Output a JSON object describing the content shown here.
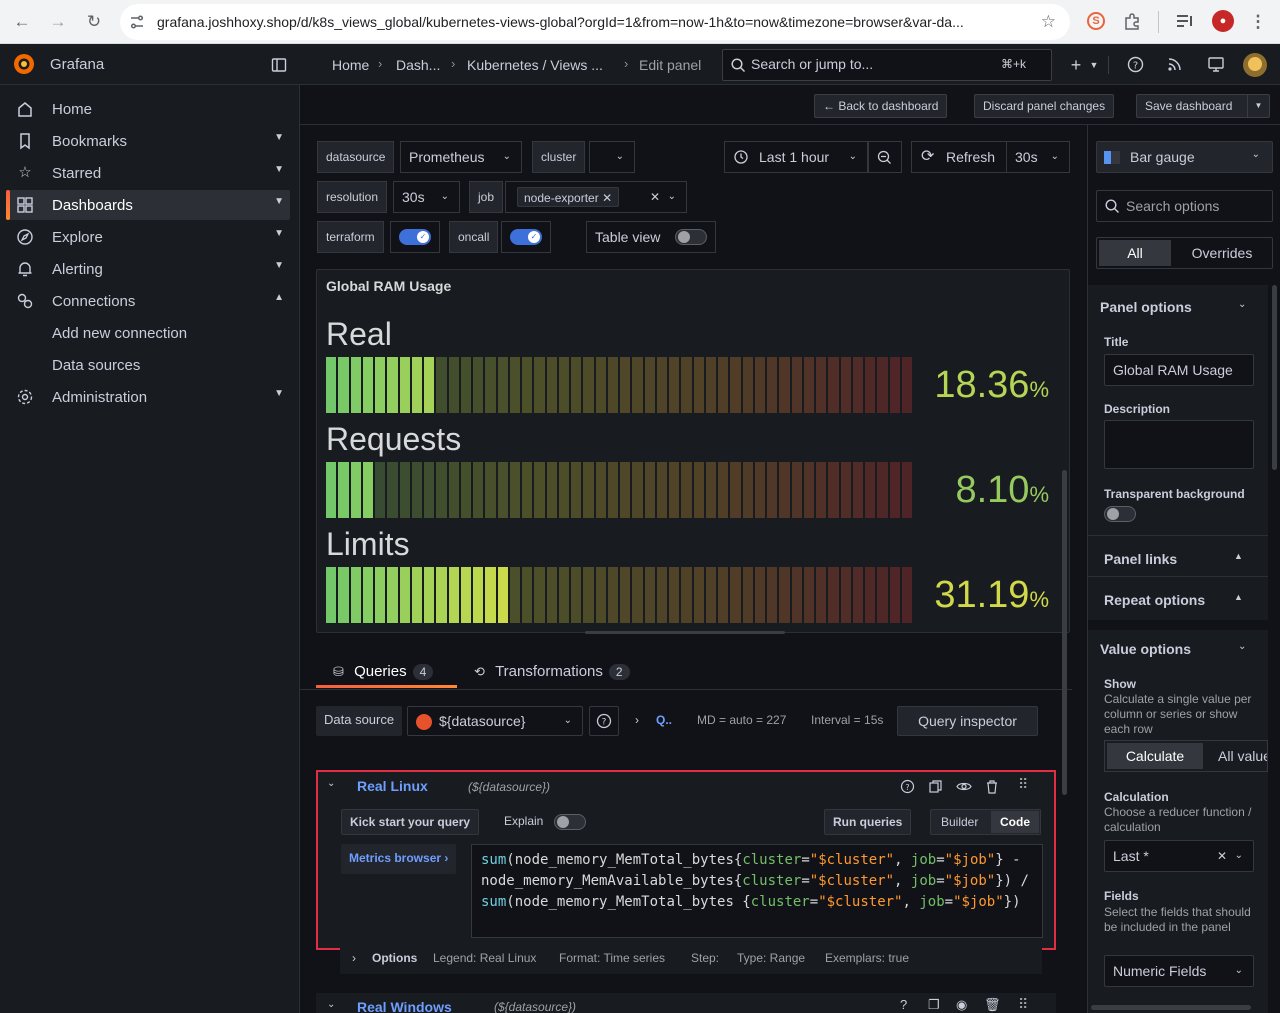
{
  "browser": {
    "url": "grafana.joshhoxy.shop/d/k8s_views_global/kubernetes-views-global?orgId=1&from=now-1h&to=now&timezone=browser&var-da..."
  },
  "app": {
    "brand": "Grafana",
    "breadcrumbs": [
      "Home",
      "Dash...",
      "Kubernetes / Views ...",
      "Edit panel"
    ],
    "search_placeholder": "Search or jump to...",
    "search_shortcut": "⌘+k"
  },
  "sidebar": {
    "items": [
      {
        "label": "Home",
        "icon": "home-icon"
      },
      {
        "label": "Bookmarks",
        "icon": "bookmark-icon"
      },
      {
        "label": "Starred",
        "icon": "star-icon"
      },
      {
        "label": "Dashboards",
        "icon": "apps-icon"
      },
      {
        "label": "Explore",
        "icon": "compass-icon"
      },
      {
        "label": "Alerting",
        "icon": "bell-icon"
      },
      {
        "label": "Connections",
        "icon": "plug-icon"
      },
      {
        "label": "Add new connection",
        "icon": ""
      },
      {
        "label": "Data sources",
        "icon": ""
      },
      {
        "label": "Administration",
        "icon": "cog-icon"
      }
    ]
  },
  "actions": {
    "back": "Back to dashboard",
    "discard": "Discard panel changes",
    "save": "Save dashboard"
  },
  "variables": {
    "datasource_label": "datasource",
    "datasource_value": "Prometheus",
    "cluster_label": "cluster",
    "resolution_label": "resolution",
    "resolution_value": "30s",
    "job_label": "job",
    "job_value": "node-exporter",
    "terraform_label": "terraform",
    "oncall_label": "oncall",
    "table_view_label": "Table view"
  },
  "time": {
    "range": "Last 1 hour",
    "refresh": "Refresh",
    "interval": "30s"
  },
  "panel": {
    "title": "Global RAM Usage",
    "gauges": [
      {
        "label": "Real",
        "value": "18.36",
        "unit": "%",
        "percent": 18.36,
        "color": "#b5d654"
      },
      {
        "label": "Requests",
        "value": "8.10",
        "unit": "%",
        "percent": 8.1,
        "color": "#96c95f"
      },
      {
        "label": "Limits",
        "value": "31.19",
        "unit": "%",
        "percent": 31.19,
        "color": "#d1d94a"
      }
    ]
  },
  "tabs": {
    "queries": "Queries",
    "queries_count": "4",
    "transformations": "Transformations",
    "transformations_count": "2"
  },
  "query_toolbar": {
    "data_source_label": "Data source",
    "data_source_value": "${datasource}",
    "query_options_short": "Q..",
    "md": "MD = auto = 227",
    "interval": "Interval = 15s",
    "inspector": "Query inspector"
  },
  "query_a": {
    "name": "Real Linux",
    "datasource": "(${datasource})",
    "kick_start": "Kick start your query",
    "explain": "Explain",
    "run": "Run queries",
    "builder": "Builder",
    "code": "Code",
    "metrics_browser": "Metrics browser",
    "options_label": "Options",
    "legend": "Legend: Real Linux",
    "format": "Format: Time series",
    "step": "Step:",
    "type": "Type: Range",
    "exemplars": "Exemplars: true"
  },
  "query_b": {
    "name": "Real Windows",
    "datasource": "(${datasource})"
  },
  "options_pane": {
    "viz": "Bar gauge",
    "search_placeholder": "Search options",
    "all_tab": "All",
    "overrides_tab": "Overrides",
    "panel_options": "Panel options",
    "title_label": "Title",
    "title_value": "Global RAM Usage",
    "description_label": "Description",
    "transparent_label": "Transparent background",
    "panel_links": "Panel links",
    "repeat_options": "Repeat options",
    "value_options": "Value options",
    "show_label": "Show",
    "show_desc": "Calculate a single value per column or series or show each row",
    "calculate": "Calculate",
    "all_values": "All values",
    "calc_label": "Calculation",
    "calc_desc": "Choose a reducer function / calculation",
    "calc_value": "Last *",
    "fields_label": "Fields",
    "fields_desc": "Select the fields that should be included in the panel",
    "fields_value": "Numeric Fields"
  }
}
